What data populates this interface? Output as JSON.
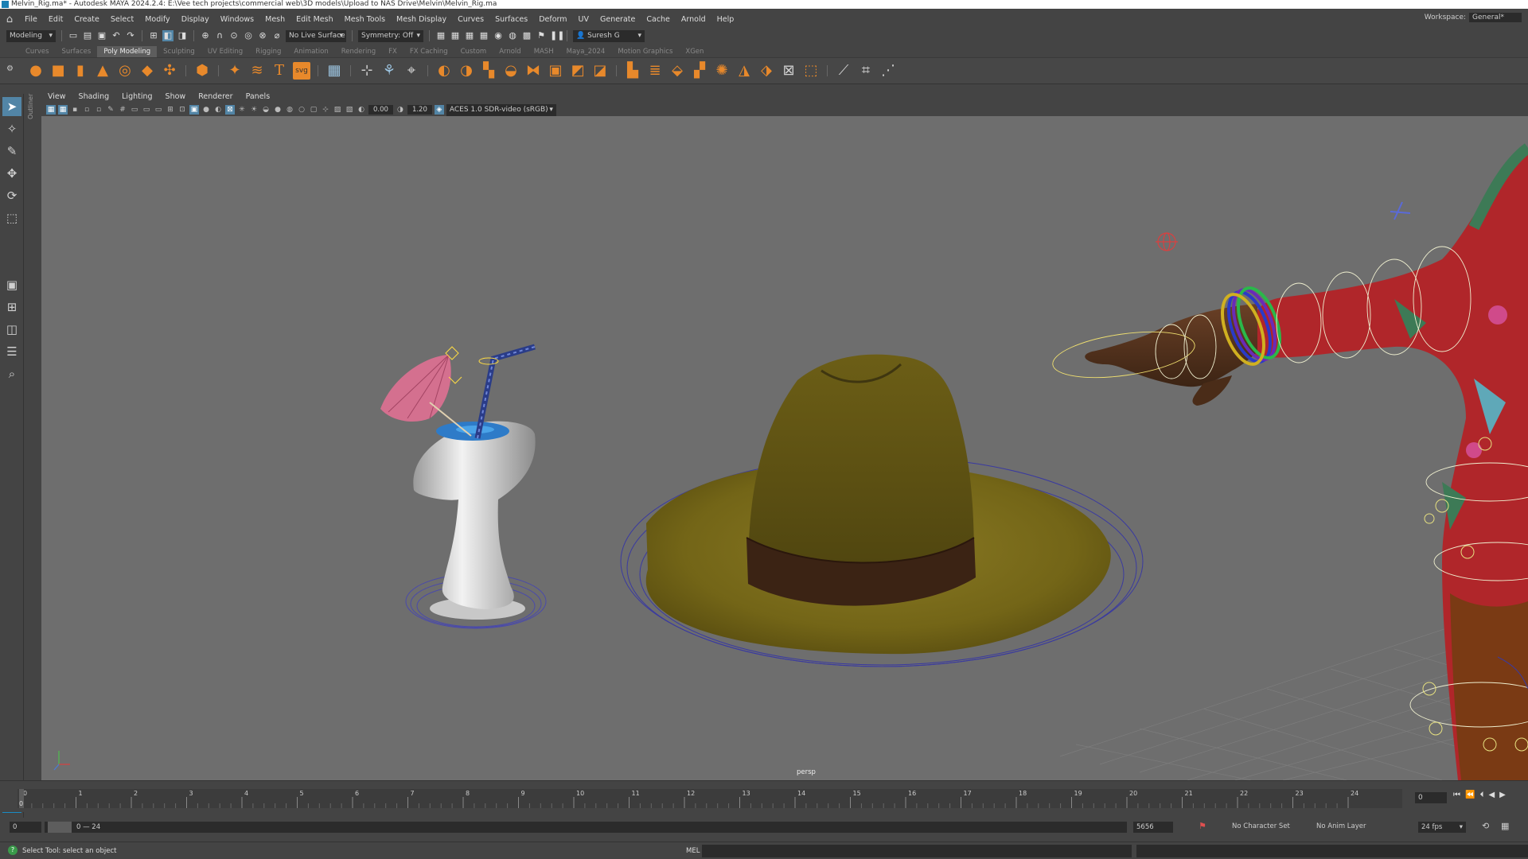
{
  "window": {
    "title": "Melvin_Rig.ma* - Autodesk MAYA 2024.2.4: E:\\Vee tech projects\\commercial web\\3D models\\Upload to NAS Drive\\Melvin\\Melvin_Rig.ma"
  },
  "menubar": {
    "items": [
      "File",
      "Edit",
      "Create",
      "Select",
      "Modify",
      "Display",
      "Windows",
      "Mesh",
      "Edit Mesh",
      "Mesh Tools",
      "Mesh Display",
      "Curves",
      "Surfaces",
      "Deform",
      "UV",
      "Generate",
      "Cache",
      "Arnold",
      "Help"
    ],
    "workspace_label": "Workspace:",
    "workspace_value": "General*"
  },
  "statusline": {
    "menuset": "Modeling",
    "live_surface": "No Live Surface",
    "symmetry": "Symmetry: Off",
    "user": "Suresh G"
  },
  "shelf": {
    "tabs": [
      "Curves",
      "Surfaces",
      "Poly Modeling",
      "Sculpting",
      "UV Editing",
      "Rigging",
      "Animation",
      "Rendering",
      "FX",
      "FX Caching",
      "Custom",
      "Arnold",
      "MASH",
      "Maya_2024",
      "Motion Graphics",
      "XGen"
    ],
    "active_tab": "Poly Modeling",
    "icons": [
      "sphere-icon",
      "cube-icon",
      "cylinder-icon",
      "cone-icon",
      "torus-icon",
      "plane-icon",
      "disc-icon",
      "platonic-icon",
      "super-shape-icon",
      "sweep-mesh-icon",
      "type-icon",
      "svg-icon",
      "combine-icon",
      "separate-icon",
      "smooth-icon",
      "bool-icon",
      "mirror-icon",
      "extrude-icon",
      "bridge-icon",
      "bevel-icon",
      "fill-hole-icon",
      "multi-cut-icon",
      "target-weld-icon",
      "connect-icon",
      "knife-icon"
    ]
  },
  "panel": {
    "menus": [
      "View",
      "Shading",
      "Lighting",
      "Show",
      "Renderer",
      "Panels"
    ],
    "exposure": "0.00",
    "gamma": "1.20",
    "color_space": "ACES 1.0 SDR-video (sRGB)",
    "camera_label": "persp",
    "outliner_label": "Outliner"
  },
  "timeslider": {
    "frames": [
      "0",
      "1",
      "2",
      "3",
      "4",
      "5",
      "6",
      "7",
      "8",
      "9",
      "10",
      "11",
      "12",
      "13",
      "14",
      "15",
      "16",
      "17",
      "18",
      "19",
      "20",
      "21",
      "22",
      "23",
      "24"
    ],
    "current_frame": "0",
    "playhead_label": "0"
  },
  "rangeslider": {
    "start": "0",
    "range_start_inner": "0",
    "range_text": "0 — 24",
    "end_value": "5656",
    "character_set": "No Character Set",
    "anim_layer": "No Anim Layer",
    "fps": "24 fps"
  },
  "helpline": {
    "text": "Select Tool: select an object",
    "mel_label": "MEL"
  },
  "colors": {
    "ui_bg": "#444444",
    "viewport_bg": "#6e6e6e",
    "accent": "#5285a6",
    "shelf_icon": "#e8892b",
    "hat": "#7a6a1a",
    "hat_band": "#3b2314",
    "glass": "#dcdcdc",
    "umbrella": "#d4708f",
    "shirt": "#c0302a",
    "skin": "#5a3620"
  }
}
